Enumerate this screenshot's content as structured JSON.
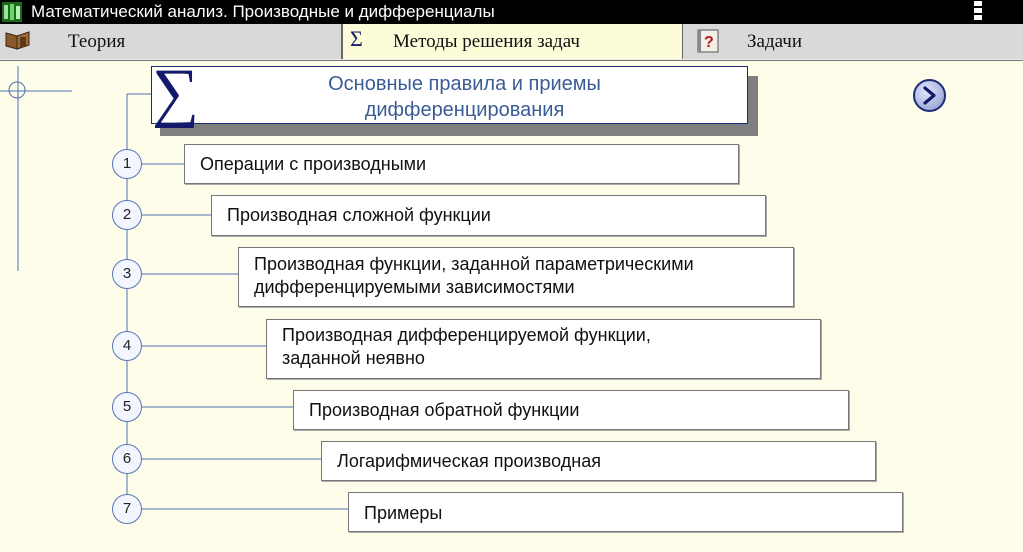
{
  "window": {
    "title": "Математический анализ. Производные и дифференциалы"
  },
  "tabs": [
    {
      "label": "Теория",
      "icon": "book-icon"
    },
    {
      "label": "Методы решения задач",
      "icon": "sigma-icon",
      "icon_glyph": "Σ",
      "selected": true
    },
    {
      "label": "Задачи",
      "icon": "question-book-icon"
    }
  ],
  "header": {
    "sigma": "∑",
    "line1": "Основные правила и приемы",
    "line2": "дифференцирования"
  },
  "items": [
    {
      "number": "1",
      "lines": [
        "Операции с производными"
      ]
    },
    {
      "number": "2",
      "lines": [
        "Производная сложной функции"
      ]
    },
    {
      "number": "3",
      "lines": [
        "Производная функции, заданной параметрическими",
        "дифференцируемыми зависимостями"
      ]
    },
    {
      "number": "4",
      "lines": [
        "Производная дифференцируемой функции,",
        "заданной неявно"
      ]
    },
    {
      "number": "5",
      "lines": [
        "Производная обратной функции"
      ]
    },
    {
      "number": "6",
      "lines": [
        "Логарифмическая производная"
      ]
    },
    {
      "number": "7",
      "lines": [
        "Примеры"
      ]
    }
  ],
  "colors": {
    "background": "#fdfde9",
    "accent": "#1c2a7a",
    "header_text": "#3b5c93",
    "tree_line": "#4f6fb5"
  }
}
